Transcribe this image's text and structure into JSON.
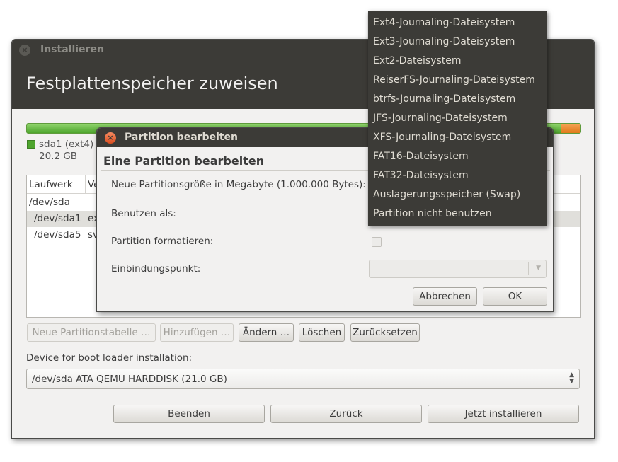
{
  "window": {
    "title": "Installieren",
    "header": "Festplattenspeicher zuweisen"
  },
  "legend": {
    "name": "sda1 (ext4)",
    "size": "20.2 GB",
    "color": "#4ea52d"
  },
  "table": {
    "headers": [
      "Laufwerk",
      "Ve"
    ],
    "rows": [
      {
        "device": "/dev/sda",
        "type": ""
      },
      {
        "device": "/dev/sda1",
        "type": "ex"
      },
      {
        "device": "/dev/sda5",
        "type": "sv"
      }
    ]
  },
  "buttons": {
    "new_table": "Neue Partitionstabelle …",
    "add": "Hinzufügen …",
    "change": "Ändern …",
    "delete": "Löschen",
    "revert": "Zurücksetzen"
  },
  "boot": {
    "label": "Device for boot loader installation:",
    "value": "/dev/sda ATA QEMU HARDDISK (21.0 GB)"
  },
  "nav": {
    "quit": "Beenden",
    "back": "Zurück",
    "install": "Jetzt installieren"
  },
  "dialog": {
    "title": "Partition bearbeiten",
    "heading": "Eine Partition bearbeiten",
    "size_label": "Neue Partitionsgröße in Megabyte (1.000.000 Bytes):",
    "use_as_label": "Benutzen als:",
    "format_label": "Partition formatieren:",
    "mount_label": "Einbindungspunkt:",
    "cancel": "Abbrechen",
    "ok": "OK"
  },
  "menu": {
    "items": [
      "Ext4-Journaling-Dateisystem",
      "Ext3-Journaling-Dateisystem",
      "Ext2-Dateisystem",
      "ReiserFS-Journaling-Dateisystem",
      "btrfs-Journaling-Dateisystem",
      "JFS-Journaling-Dateisystem",
      "XFS-Journaling-Dateisystem",
      "FAT16-Dateisystem",
      "FAT32-Dateisystem",
      "Auslagerungsspeicher (Swap)",
      "Partition nicht benutzen"
    ]
  },
  "colors": {
    "titlebar": "#3c3b37",
    "ext4": "#4ea52d",
    "swap": "#e07a1a",
    "close_active": "#d94d1f"
  }
}
